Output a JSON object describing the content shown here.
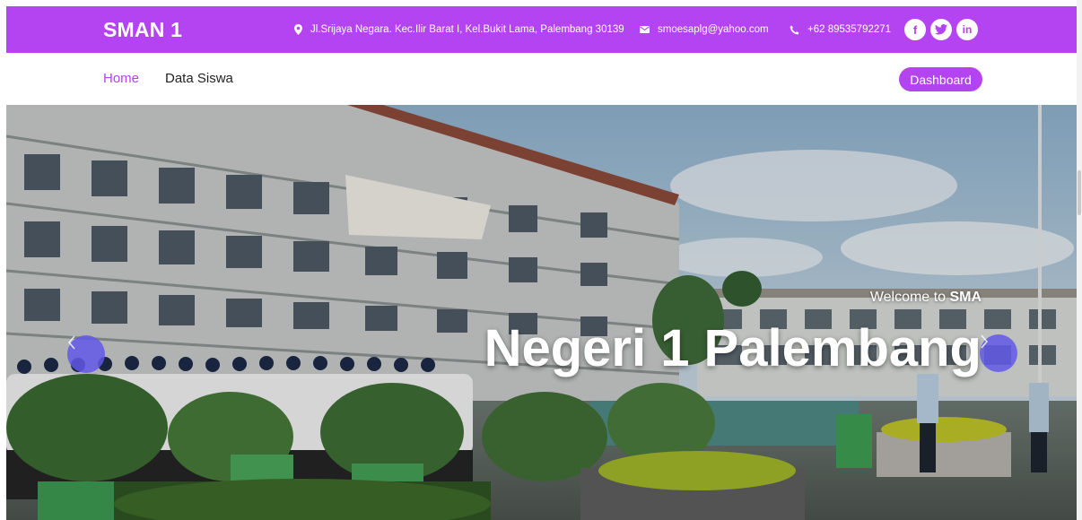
{
  "topbar": {
    "brand": "SMAN 1",
    "address": "Jl.Srijaya Negara. Kec.Ilir Barat I, Kel.Bukit Lama, Palembang 30139",
    "email": "smoesaplg@yahoo.com",
    "phone": "+62 89535792271",
    "socials": [
      "facebook-icon",
      "twitter-icon",
      "linkedin-icon"
    ],
    "color": "#b443f2"
  },
  "nav": {
    "home": "Home",
    "data_siswa": "Data Siswa",
    "dashboard": "Dashboard"
  },
  "hero": {
    "welcome_prefix": "Welcome to ",
    "welcome_bold": "SMA",
    "headline": "Negeri 1 Palembang",
    "prev_icon": "chevron-left-icon",
    "next_icon": "chevron-right-icon"
  }
}
